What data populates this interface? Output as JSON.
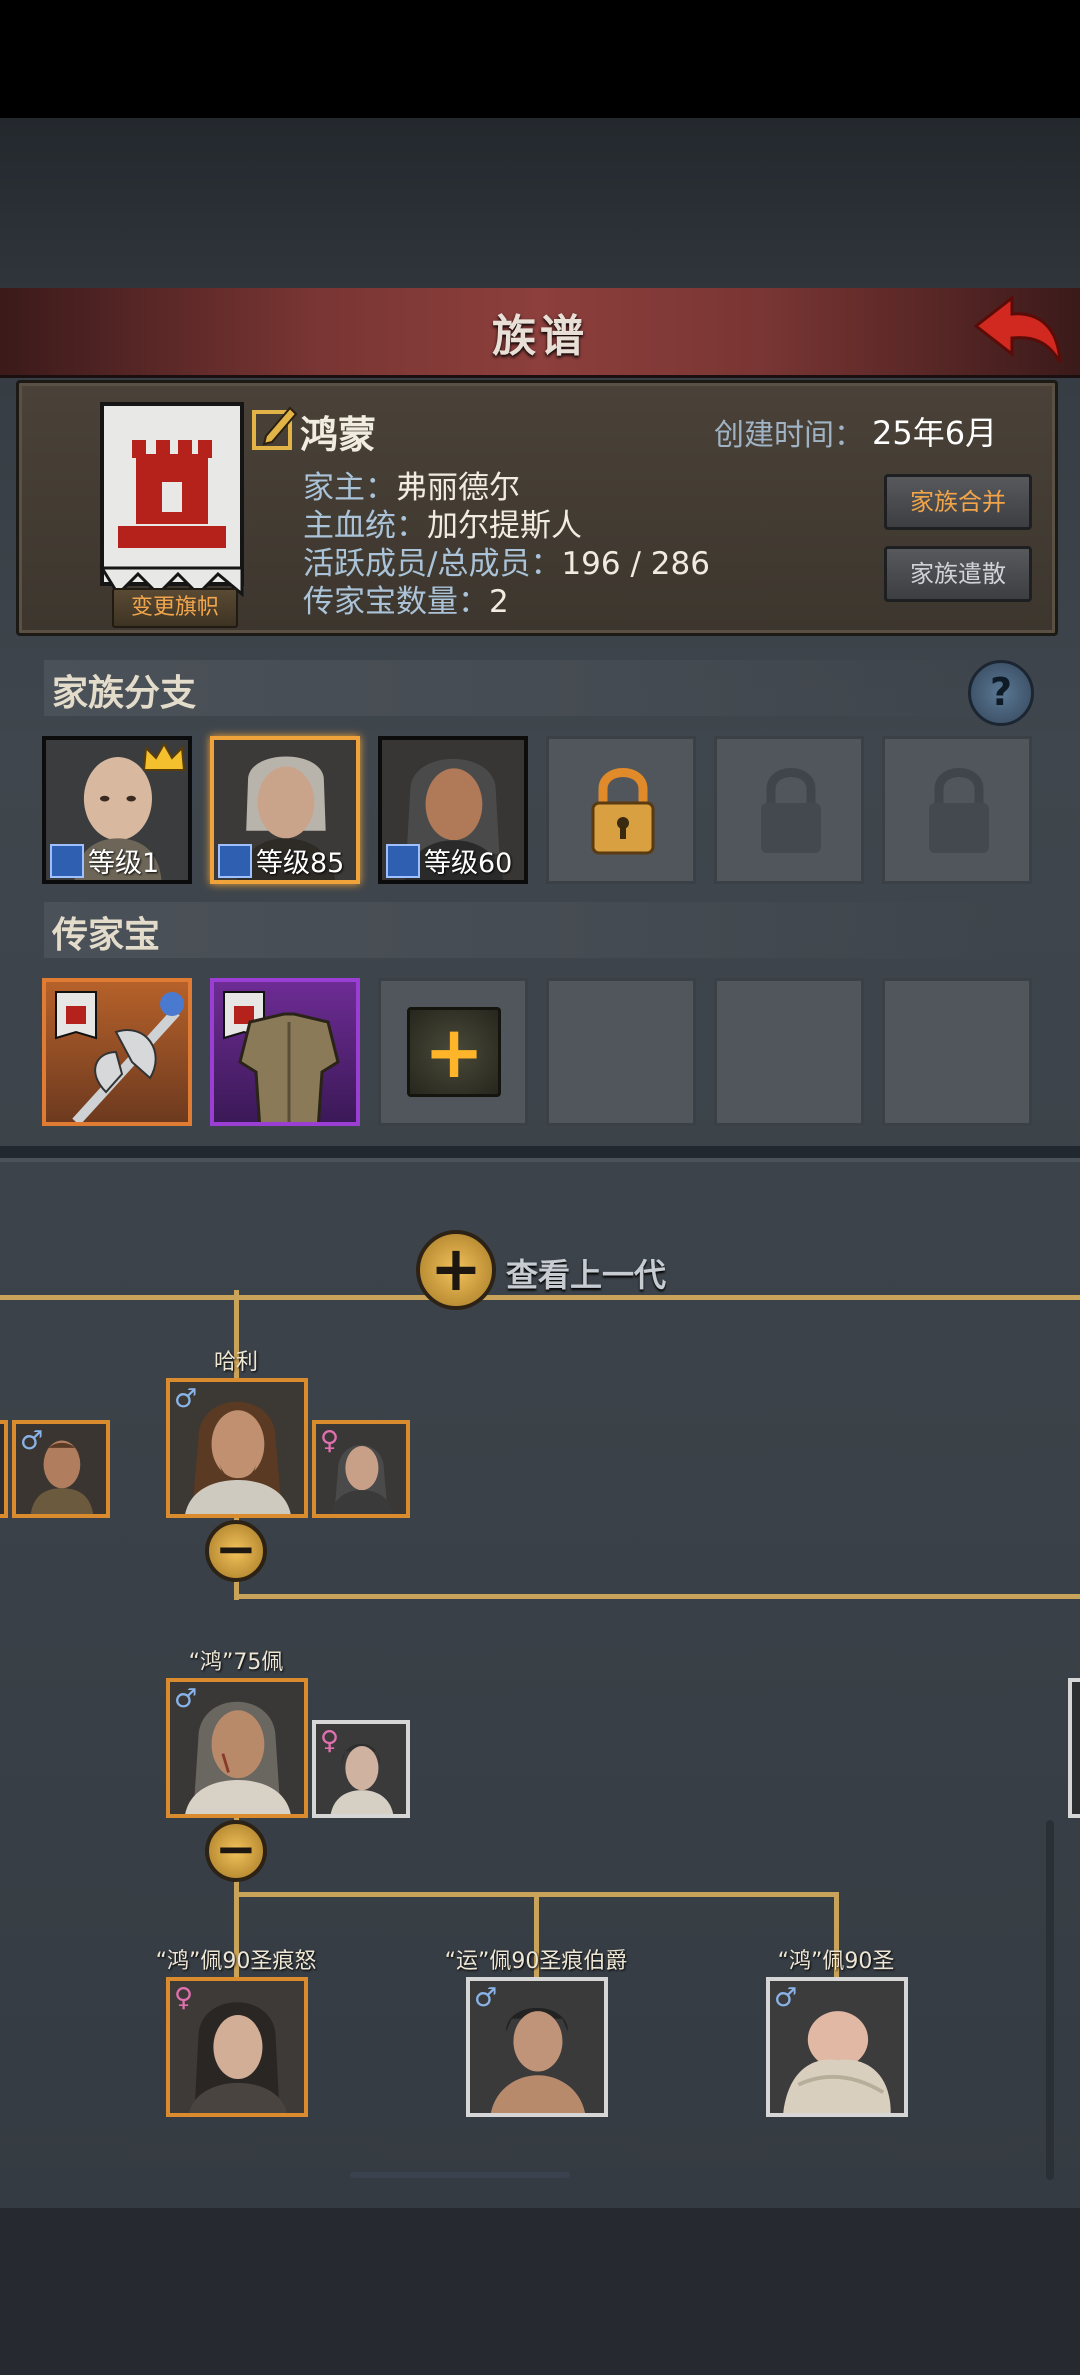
{
  "header": {
    "title": "族谱"
  },
  "family": {
    "banner_button": "变更旗帜",
    "name": "鸿蒙",
    "created_label": "创建时间：",
    "created_value": "25年6月",
    "head_label": "家主：",
    "head_value": "弗丽德尔",
    "bloodline_label": "主血统：",
    "bloodline_value": "加尔提斯人",
    "members_label": "活跃成员/总成员：",
    "members_value": "196 / 286",
    "heirloom_count_label": "传家宝数量：",
    "heirloom_count_value": "2",
    "merge_button": "家族合并",
    "disband_button": "家族遣散"
  },
  "branches": {
    "title": "家族分支",
    "help": "?",
    "heroes": [
      {
        "level_text": "等级1",
        "leader": true,
        "selected": false
      },
      {
        "level_text": "等级85",
        "leader": false,
        "selected": true
      },
      {
        "level_text": "等级60",
        "leader": false,
        "selected": false
      }
    ],
    "locked_slots": 3
  },
  "heirlooms": {
    "title": "传家宝",
    "items": [
      {
        "rarity": "orange",
        "icon": "halberd-icon"
      },
      {
        "rarity": "purple",
        "icon": "armor-icon"
      }
    ],
    "add": "+",
    "empty_slots": 4
  },
  "tree": {
    "view_previous": "查看上一代",
    "collapse": "−",
    "gen1": {
      "name": "哈利",
      "gender": "♂"
    },
    "gen2": {
      "name": "“鸿”75佩",
      "gender": "♂"
    },
    "gen3": [
      {
        "name": "“鸿”佩90圣痕怒",
        "gender": "♀"
      },
      {
        "name": "“运”佩90圣痕伯爵",
        "gender": "♂"
      },
      {
        "name": "“鸿”佩90圣",
        "gender": "♂"
      }
    ],
    "spouse_genders": [
      "♂",
      "♀",
      "♀"
    ]
  },
  "colors": {
    "accent": "#f0a33a",
    "tree_line": "#c9a35a",
    "header_red": "#8c3f3c"
  }
}
